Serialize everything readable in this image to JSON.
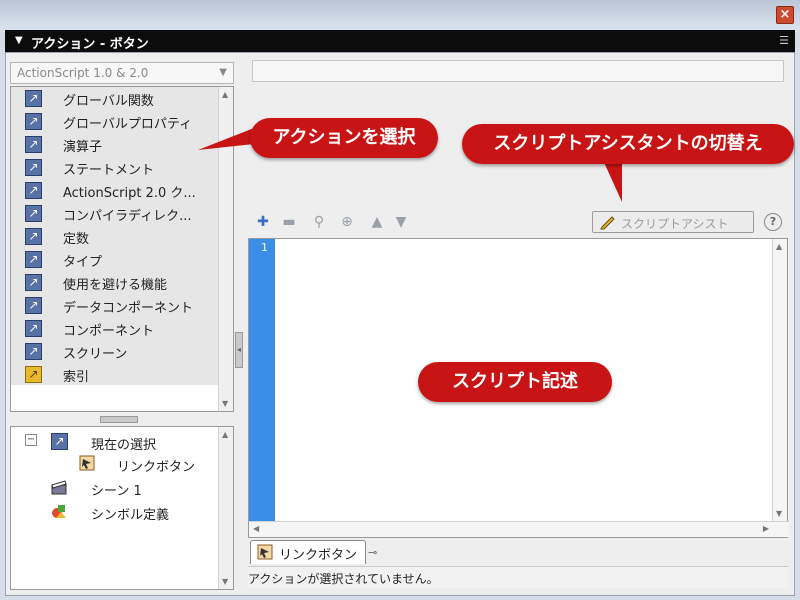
{
  "panel": {
    "title": "アクション - ボタン",
    "menu_icon": "panel-menu-icon"
  },
  "toolbox": {
    "version": "ActionScript 1.0 & 2.0",
    "items": [
      {
        "label": "グローバル関数",
        "icon": "book-icon"
      },
      {
        "label": "グローバルプロパティ",
        "icon": "book-icon"
      },
      {
        "label": "演算子",
        "icon": "book-icon"
      },
      {
        "label": "ステートメント",
        "icon": "book-icon"
      },
      {
        "label": "ActionScript 2.0 ク...",
        "icon": "book-icon"
      },
      {
        "label": "コンパイラディレク...",
        "icon": "book-icon"
      },
      {
        "label": "定数",
        "icon": "book-icon"
      },
      {
        "label": "タイプ",
        "icon": "book-icon"
      },
      {
        "label": "使用を避ける機能",
        "icon": "book-icon"
      },
      {
        "label": "データコンポーネント",
        "icon": "book-icon"
      },
      {
        "label": "コンポーネント",
        "icon": "book-icon"
      },
      {
        "label": "スクリーン",
        "icon": "book-icon"
      },
      {
        "label": "索引",
        "icon": "index-book-icon"
      }
    ]
  },
  "script_nav": {
    "current_selection": "現在の選択",
    "link_button": "リンクボタン",
    "scene": "シーン 1",
    "symbol_defs": "シンボル定義"
  },
  "toolbar": {
    "assist_label": "スクリプトアシスト"
  },
  "editor": {
    "line_number": "1"
  },
  "tabs": [
    {
      "label": "リンクボタン"
    }
  ],
  "status": {
    "text": "アクションが選択されていません。"
  },
  "callouts": {
    "select_action": "アクションを選択",
    "assist_toggle": "スクリプトアシスタントの切替え",
    "script_write": "スクリプト記述"
  },
  "colors": {
    "callout": "#c81414",
    "gutter": "#3a8ee6",
    "panel_bar": "#0c0c0c"
  }
}
